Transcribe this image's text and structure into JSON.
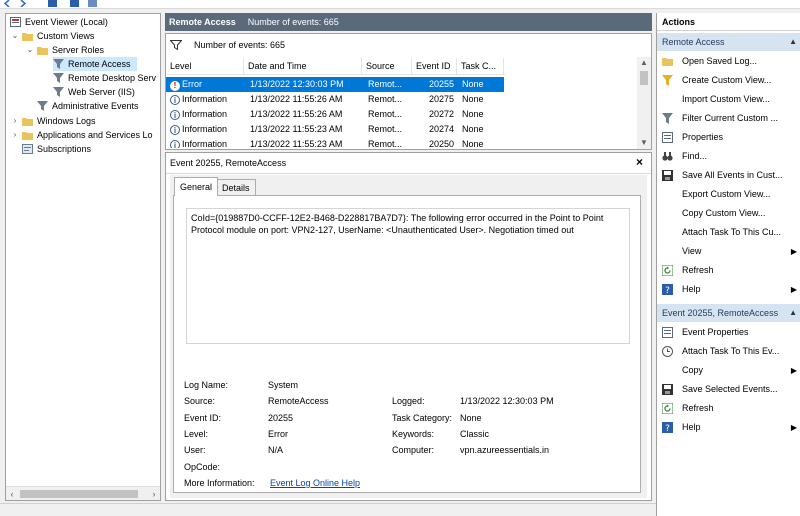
{
  "tree": {
    "items": [
      {
        "label": "Event Viewer (Local)"
      },
      {
        "label": "Custom Views"
      },
      {
        "label": "Server Roles"
      },
      {
        "label": "Remote Access"
      },
      {
        "label": "Remote Desktop Serv"
      },
      {
        "label": "Web Server (IIS)"
      },
      {
        "label": "Administrative Events"
      },
      {
        "label": "Windows Logs"
      },
      {
        "label": "Applications and Services Lo"
      },
      {
        "label": "Subscriptions"
      }
    ]
  },
  "center": {
    "title": "Remote Access",
    "count_text": "Number of events: 665",
    "filter_text": "Number of events: 665"
  },
  "columns": [
    "Level",
    "Date and Time",
    "Source",
    "Event ID",
    "Task C..."
  ],
  "rows": [
    {
      "level": "Error",
      "date": "1/13/2022 12:30:03 PM",
      "source": "Remot...",
      "event_id": "20255",
      "task": "None"
    },
    {
      "level": "Information",
      "date": "1/13/2022 11:55:26 AM",
      "source": "Remot...",
      "event_id": "20275",
      "task": "None"
    },
    {
      "level": "Information",
      "date": "1/13/2022 11:55:26 AM",
      "source": "Remot...",
      "event_id": "20272",
      "task": "None"
    },
    {
      "level": "Information",
      "date": "1/13/2022 11:55:23 AM",
      "source": "Remot...",
      "event_id": "20274",
      "task": "None"
    },
    {
      "level": "Information",
      "date": "1/13/2022 11:55:23 AM",
      "source": "Remot...",
      "event_id": "20250",
      "task": "None"
    }
  ],
  "details": {
    "title": "Event 20255, RemoteAccess",
    "close_glyph": "×",
    "tabs": [
      "General",
      "Details"
    ],
    "message": "CoId={019887D0-CCFF-12E2-B468-D228817BA7D7}: The following error occurred in the Point to Point Protocol module on port: VPN2-127, UserName: <Unauthenticated User>. Negotiation timed out",
    "labels": {
      "log_name": "Log Name:",
      "source": "Source:",
      "event_id": "Event ID:",
      "level": "Level:",
      "user": "User:",
      "opcode": "OpCode:",
      "more_info": "More Information:",
      "logged": "Logged:",
      "task_category": "Task Category:",
      "keywords": "Keywords:",
      "computer": "Computer:"
    },
    "values": {
      "log_name": "System",
      "source": "RemoteAccess",
      "event_id": "20255",
      "level": "Error",
      "user": "N/A",
      "opcode": "",
      "more_info_link": "Event Log Online Help",
      "logged": "1/13/2022 12:30:03 PM",
      "task_category": "None",
      "keywords": "Classic",
      "computer": "vpn.azureessentials.in"
    }
  },
  "actions": {
    "header": "Actions",
    "section1": "Remote Access",
    "section1_items": [
      {
        "label": "Open Saved Log...",
        "icon": "folder-icon"
      },
      {
        "label": "Create Custom View...",
        "icon": "filter-icon"
      },
      {
        "label": "Import Custom View...",
        "icon": "none"
      },
      {
        "label": "Filter Current Custom ...",
        "icon": "filter-icon"
      },
      {
        "label": "Properties",
        "icon": "properties-icon"
      },
      {
        "label": "Find...",
        "icon": "binoculars-icon"
      },
      {
        "label": "Save All Events in Cust...",
        "icon": "save-icon"
      },
      {
        "label": "Export Custom View...",
        "icon": "none"
      },
      {
        "label": "Copy Custom View...",
        "icon": "none"
      },
      {
        "label": "Attach Task To This Cu...",
        "icon": "none"
      },
      {
        "label": "View",
        "icon": "none"
      },
      {
        "label": "Refresh",
        "icon": "refresh-icon"
      },
      {
        "label": "Help",
        "icon": "help-icon"
      }
    ],
    "section2": "Event 20255, RemoteAccess",
    "section2_items": [
      {
        "label": "Event Properties",
        "icon": "properties-icon"
      },
      {
        "label": "Attach Task To This Ev...",
        "icon": "task-icon"
      },
      {
        "label": "Copy",
        "icon": "none"
      },
      {
        "label": "Save Selected Events...",
        "icon": "save-icon"
      },
      {
        "label": "Refresh",
        "icon": "refresh-icon"
      },
      {
        "label": "Help",
        "icon": "help-icon"
      }
    ]
  },
  "colors": {
    "header_bg": "#5a6a7a",
    "selection": "#0078d7",
    "section_bg": "#d6e3f1",
    "link": "#0645ad"
  }
}
